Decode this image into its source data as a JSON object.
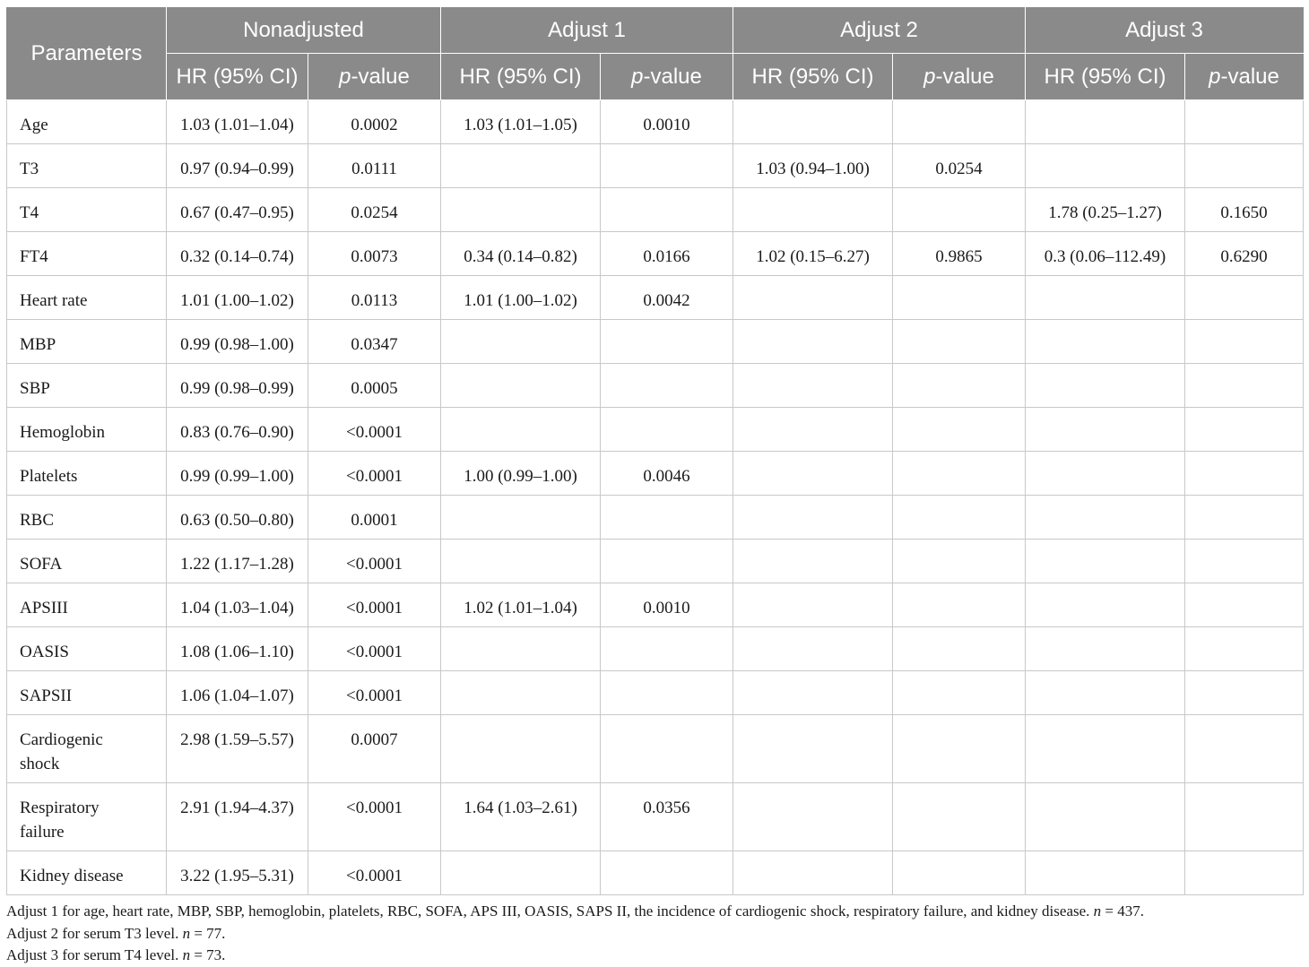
{
  "header": {
    "parameters": "Parameters",
    "groups": [
      "Nonadjusted",
      "Adjust 1",
      "Adjust 2",
      "Adjust 3"
    ],
    "hr_label": "HR (95% CI)",
    "p_italic": "p",
    "p_rest": "-value"
  },
  "rows": [
    {
      "label": "Age",
      "cells": [
        "1.03 (1.01–1.04)",
        "0.0002",
        "1.03 (1.01–1.05)",
        "0.0010",
        "",
        "",
        "",
        ""
      ]
    },
    {
      "label": "T3",
      "cells": [
        "0.97 (0.94–0.99)",
        "0.0111",
        "",
        "",
        "1.03 (0.94–1.00)",
        "0.0254",
        "",
        ""
      ]
    },
    {
      "label": "T4",
      "cells": [
        "0.67 (0.47–0.95)",
        "0.0254",
        "",
        "",
        "",
        "",
        "1.78 (0.25–1.27)",
        "0.1650"
      ]
    },
    {
      "label": "FT4",
      "cells": [
        "0.32 (0.14–0.74)",
        "0.0073",
        "0.34 (0.14–0.82)",
        "0.0166",
        "1.02 (0.15–6.27)",
        "0.9865",
        "0.3 (0.06–112.49)",
        "0.6290"
      ]
    },
    {
      "label": "Heart rate",
      "cells": [
        "1.01 (1.00–1.02)",
        "0.0113",
        "1.01 (1.00–1.02)",
        "0.0042",
        "",
        "",
        "",
        ""
      ]
    },
    {
      "label": "MBP",
      "cells": [
        "0.99 (0.98–1.00)",
        "0.0347",
        "",
        "",
        "",
        "",
        "",
        ""
      ]
    },
    {
      "label": "SBP",
      "cells": [
        "0.99 (0.98–0.99)",
        "0.0005",
        "",
        "",
        "",
        "",
        "",
        ""
      ]
    },
    {
      "label": "Hemoglobin",
      "cells": [
        "0.83 (0.76–0.90)",
        "<0.0001",
        "",
        "",
        "",
        "",
        "",
        ""
      ]
    },
    {
      "label": "Platelets",
      "cells": [
        "0.99 (0.99–1.00)",
        "<0.0001",
        "1.00 (0.99–1.00)",
        "0.0046",
        "",
        "",
        "",
        ""
      ]
    },
    {
      "label": "RBC",
      "cells": [
        "0.63 (0.50–0.80)",
        "0.0001",
        "",
        "",
        "",
        "",
        "",
        ""
      ]
    },
    {
      "label": "SOFA",
      "cells": [
        "1.22 (1.17–1.28)",
        "<0.0001",
        "",
        "",
        "",
        "",
        "",
        ""
      ]
    },
    {
      "label": "APSIII",
      "cells": [
        "1.04 (1.03–1.04)",
        "<0.0001",
        "1.02 (1.01–1.04)",
        "0.0010",
        "",
        "",
        "",
        ""
      ]
    },
    {
      "label": "OASIS",
      "cells": [
        "1.08 (1.06–1.10)",
        "<0.0001",
        "",
        "",
        "",
        "",
        "",
        ""
      ]
    },
    {
      "label": "SAPSII",
      "cells": [
        "1.06 (1.04–1.07)",
        "<0.0001",
        "",
        "",
        "",
        "",
        "",
        ""
      ]
    },
    {
      "label": "Cardiogenic shock",
      "label_lines": [
        "Cardiogenic",
        "shock"
      ],
      "cells": [
        "2.98 (1.59–5.57)",
        "0.0007",
        "",
        "",
        "",
        "",
        "",
        ""
      ]
    },
    {
      "label": "Respiratory failure",
      "label_lines": [
        "Respiratory",
        "failure"
      ],
      "cells": [
        "2.91 (1.94–4.37)",
        "<0.0001",
        "1.64 (1.03–2.61)",
        "0.0356",
        "",
        "",
        "",
        ""
      ]
    },
    {
      "label": "Kidney disease",
      "cells": [
        "3.22 (1.95–5.31)",
        "<0.0001",
        "",
        "",
        "",
        "",
        "",
        ""
      ]
    }
  ],
  "notes": {
    "adjust1_text": "Adjust 1 for age, heart rate, MBP, SBP, hemoglobin, platelets, RBC, SOFA, APS III, OASIS, SAPS II, the incidence of cardiogenic shock, respiratory failure, and kidney disease. ",
    "adjust1_n": "= 437.",
    "adjust2_text": "Adjust 2 for serum T3 level. ",
    "adjust2_n": "= 77.",
    "adjust3_text": "Adjust 3 for serum T4 level. ",
    "adjust3_n": "= 73.",
    "n_symbol": "n"
  }
}
